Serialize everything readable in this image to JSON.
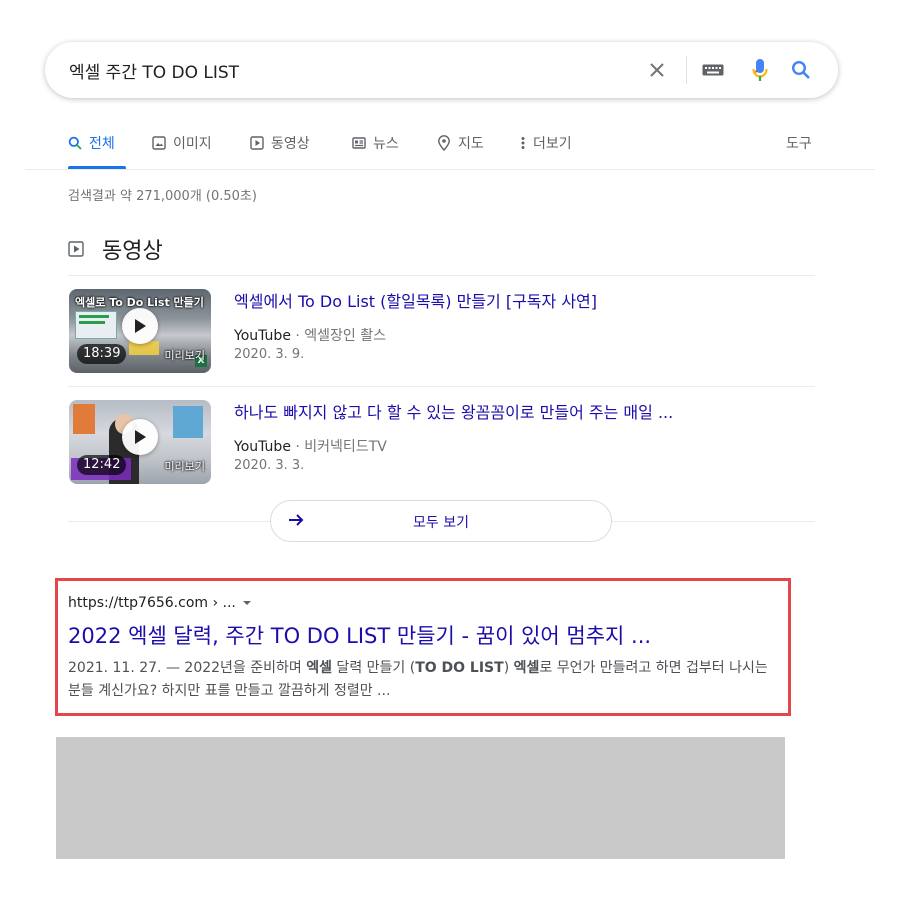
{
  "search": {
    "query": "엑셀 주간 TO DO LIST"
  },
  "tabs": {
    "items": [
      {
        "id": "all",
        "label": "전체"
      },
      {
        "id": "images",
        "label": "이미지"
      },
      {
        "id": "videos",
        "label": "동영상"
      },
      {
        "id": "news",
        "label": "뉴스"
      },
      {
        "id": "maps",
        "label": "지도"
      },
      {
        "id": "more",
        "label": "더보기"
      }
    ],
    "tools_label": "도구",
    "active": "all"
  },
  "result_stats": "검색결과 약 271,000개 (0.50초)",
  "video_section": {
    "heading": "동영상",
    "videos": [
      {
        "title": "엑셀에서 To Do List (할일목록) 만들기 [구독자 사연]",
        "source": "YouTube",
        "separator": " · ",
        "channel": "엑셀장인 촬스",
        "date": "2020. 3. 9.",
        "duration": "18:39",
        "preview_label": "미리보기",
        "thumbnail_caption": "엑셀로 To Do List 만들기"
      },
      {
        "title": "하나도 빠지지 않고 다 할 수 있는 왕꼼꼼이로 만들어 주는 매일 ...",
        "source": "YouTube",
        "separator": " · ",
        "channel": "비커넥티드TV",
        "date": "2020. 3. 3.",
        "duration": "12:42",
        "preview_label": "미리보기"
      }
    ],
    "see_all_label": "모두 보기"
  },
  "result": {
    "url": "https://ttp7656.com › ...",
    "title": "2022 엑셀 달력, 주간 TO DO LIST 만들기 - 꿈이 있어 멈추지 ...",
    "snippet": {
      "date_prefix": "2021. 11. 27. — 2022년을 준비하며 ",
      "b1": "엑셀",
      "t2": " 달력 만들기 (",
      "b2": "TO DO LIST",
      "t3": ") ",
      "b3": "엑셀",
      "t4": "로 무언가 만들려고 하면 겁부터 나시는 분들 계신가요? 하지만 표를 만들고 깔끔하게 정렬만 ..."
    }
  },
  "colors": {
    "link": "#1a0dab",
    "accent": "#1a73e8",
    "highlight_border": "#e2474b",
    "placeholder_gray": "#c9c9c9"
  }
}
